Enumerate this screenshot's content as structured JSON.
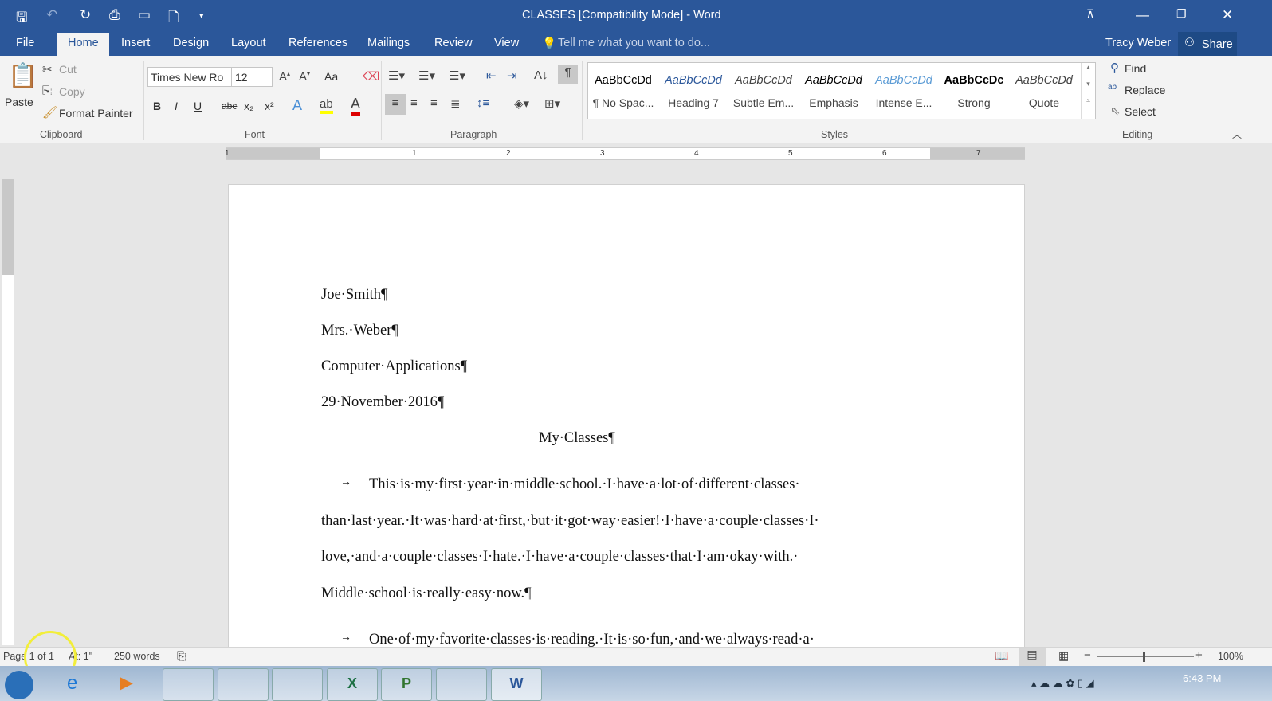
{
  "window": {
    "title": "CLASSES [Compatibility Mode] - Word",
    "user": "Tracy Weber",
    "share": "Share"
  },
  "tabs": [
    "File",
    "Home",
    "Insert",
    "Design",
    "Layout",
    "References",
    "Mailings",
    "Review",
    "View"
  ],
  "tell_me": "Tell me what you want to do...",
  "clipboard": {
    "paste": "Paste",
    "cut": "Cut",
    "copy": "Copy",
    "format_painter": "Format Painter",
    "label": "Clipboard"
  },
  "font": {
    "name": "Times New Ro",
    "size": "12",
    "label": "Font",
    "bold": "B",
    "italic": "I",
    "underline": "U",
    "strike": "abc",
    "sub": "x₂",
    "sup": "x²",
    "case": "Aa"
  },
  "paragraph": {
    "label": "Paragraph"
  },
  "styles": {
    "label": "Styles",
    "items": [
      {
        "sample": "AaBbCcDd",
        "name": "¶ No Spac..."
      },
      {
        "sample": "AaBbCcDd",
        "name": "Heading 7"
      },
      {
        "sample": "AaBbCcDd",
        "name": "Subtle Em..."
      },
      {
        "sample": "AaBbCcDd",
        "name": "Emphasis"
      },
      {
        "sample": "AaBbCcDd",
        "name": "Intense E..."
      },
      {
        "sample": "AaBbCcDc",
        "name": "Strong"
      },
      {
        "sample": "AaBbCcDd",
        "name": "Quote"
      }
    ]
  },
  "editing": {
    "find": "Find",
    "replace": "Replace",
    "select": "Select",
    "label": "Editing"
  },
  "ruler": [
    "1",
    "1",
    "2",
    "3",
    "4",
    "5",
    "6",
    "7"
  ],
  "document": {
    "lines": [
      "Joe·Smith¶",
      "Mrs.·Weber¶",
      "Computer·Applications¶",
      "29·November·2016¶"
    ],
    "title": "My·Classes¶",
    "para1": [
      "This·is·my·first·year·in·middle·school.·I·have·a·lot·of·different·classes·",
      "than·last·year.·It·was·hard·at·first,·but·it·got·way·easier!·I·have·a·couple·classes·I·",
      "love,·and·a·couple·classes·I·hate.·I·have·a·couple·classes·that·I·am·okay·with.·",
      "Middle·school·is·really·easy·now.¶"
    ],
    "para2": [
      "One·of·my·favorite·classes·is·reading.·It·is·so·fun,·and·we·always·read·a·"
    ],
    "tab_mark": "→"
  },
  "status": {
    "page": "Page 1 of 1",
    "at": "At: 1\"",
    "words": "250 words",
    "zoom": "100%"
  },
  "clock": "6:43 PM"
}
